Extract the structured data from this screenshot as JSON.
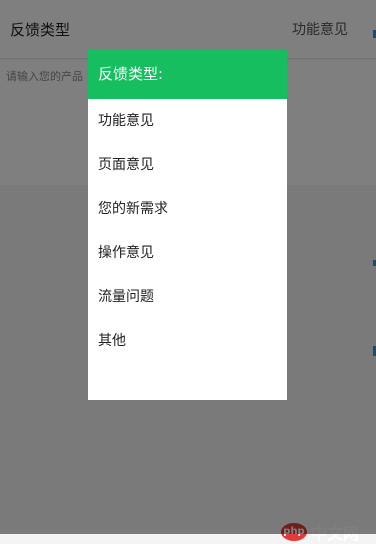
{
  "header": {
    "title": "反馈类型",
    "selected_value": "功能意见"
  },
  "content": {
    "placeholder": "请输入您的产品"
  },
  "dialog": {
    "title": "反馈类型:",
    "options": [
      {
        "label": "功能意见"
      },
      {
        "label": "页面意见"
      },
      {
        "label": "您的新需求"
      },
      {
        "label": "操作意见"
      },
      {
        "label": "流量问题"
      },
      {
        "label": "其他"
      }
    ]
  },
  "watermark": {
    "logo_text": "php",
    "text": "中文网"
  },
  "colors": {
    "dialog_title_bg": "#17be60",
    "overlay": "rgba(0,0,0,0.5)",
    "accent": "#2a9fd6"
  }
}
